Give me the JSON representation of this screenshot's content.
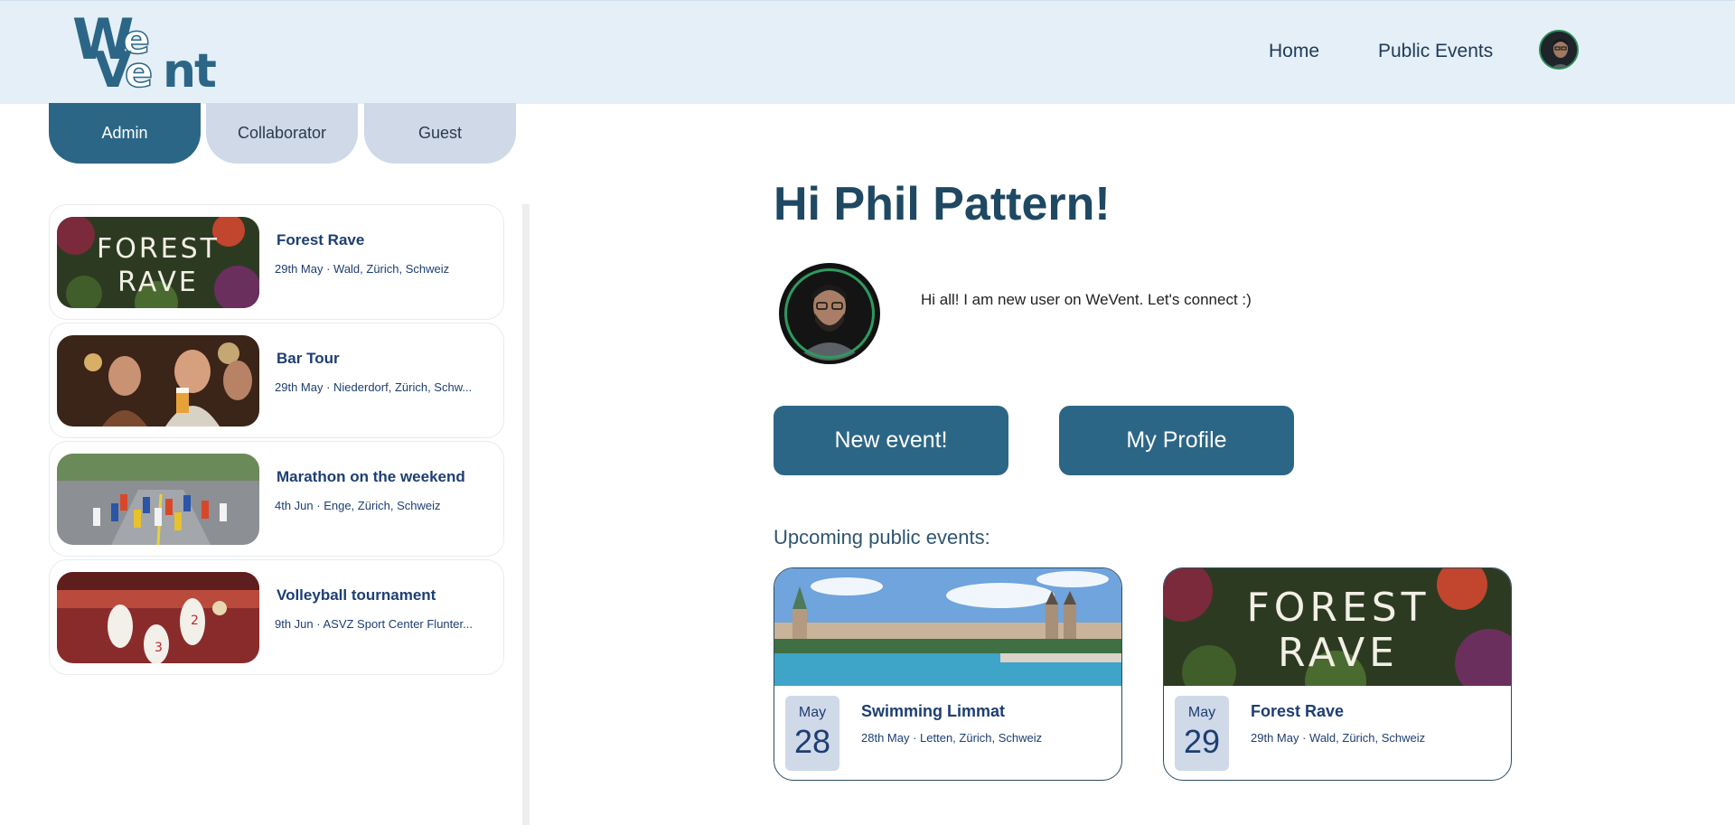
{
  "header": {
    "logo_text": "WeVent",
    "nav": [
      {
        "label": "Home"
      },
      {
        "label": "Public Events"
      }
    ]
  },
  "roles": [
    {
      "label": "Admin",
      "active": true
    },
    {
      "label": "Collaborator",
      "active": false
    },
    {
      "label": "Guest",
      "active": false
    }
  ],
  "events": [
    {
      "title": "Forest Rave",
      "subtitle": "29th May · Wald, Zürich, Schweiz",
      "image": "forest-rave-image"
    },
    {
      "title": "Bar Tour",
      "subtitle": "29th May · Niederdorf, Zürich, Schw...",
      "image": "bar-tour-image"
    },
    {
      "title": "Marathon on the weekend",
      "subtitle": "4th Jun · Enge, Zürich, Schweiz",
      "image": "marathon-image"
    },
    {
      "title": "Volleyball tournament",
      "subtitle": "9th Jun · ASVZ Sport Center Flunter...",
      "image": "volleyball-image"
    }
  ],
  "main": {
    "greeting": "Hi Phil Pattern!",
    "bio": "Hi all! I am new user on WeVent. Let's connect :)",
    "new_event_label": "New event!",
    "my_profile_label": "My Profile",
    "upcoming_label": "Upcoming public events:"
  },
  "public_events": [
    {
      "month": "May",
      "day": "28",
      "title": "Swimming Limmat",
      "subtitle": "28th May · Letten, Zürich, Schweiz",
      "image": "zurich-river-image"
    },
    {
      "month": "May",
      "day": "29",
      "title": "Forest Rave",
      "subtitle": "29th May · Wald, Zürich, Schweiz",
      "image": "forest-rave-image"
    }
  ],
  "colors": {
    "primary": "#2c6686",
    "header_bg": "#e4eff7",
    "tab_inactive": "#cfd9e8",
    "text_dark": "#1d3e73",
    "avatar_ring": "#2d9a5f"
  }
}
